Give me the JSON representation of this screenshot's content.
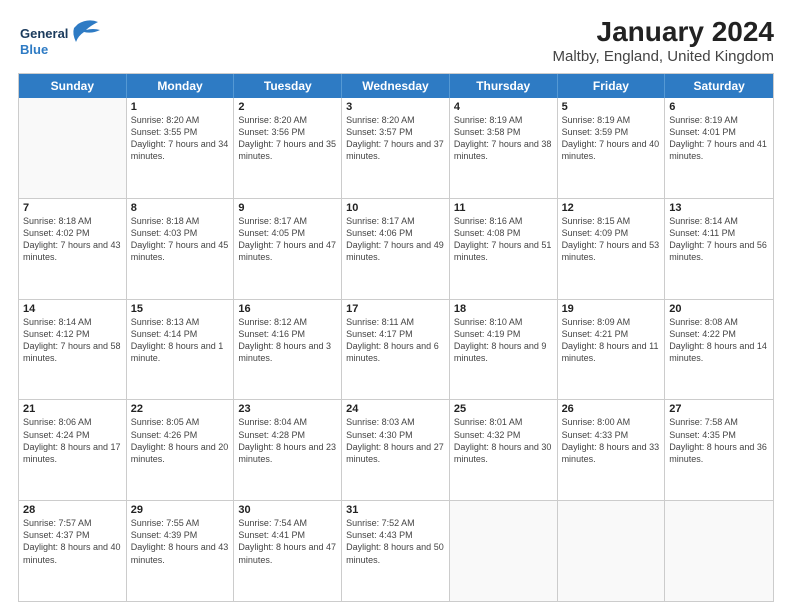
{
  "header": {
    "logo_general": "General",
    "logo_blue": "Blue",
    "month": "January 2024",
    "location": "Maltby, England, United Kingdom"
  },
  "days_of_week": [
    "Sunday",
    "Monday",
    "Tuesday",
    "Wednesday",
    "Thursday",
    "Friday",
    "Saturday"
  ],
  "weeks": [
    [
      {
        "day": "",
        "sunrise": "",
        "sunset": "",
        "daylight": ""
      },
      {
        "day": "1",
        "sunrise": "Sunrise: 8:20 AM",
        "sunset": "Sunset: 3:55 PM",
        "daylight": "Daylight: 7 hours and 34 minutes."
      },
      {
        "day": "2",
        "sunrise": "Sunrise: 8:20 AM",
        "sunset": "Sunset: 3:56 PM",
        "daylight": "Daylight: 7 hours and 35 minutes."
      },
      {
        "day": "3",
        "sunrise": "Sunrise: 8:20 AM",
        "sunset": "Sunset: 3:57 PM",
        "daylight": "Daylight: 7 hours and 37 minutes."
      },
      {
        "day": "4",
        "sunrise": "Sunrise: 8:19 AM",
        "sunset": "Sunset: 3:58 PM",
        "daylight": "Daylight: 7 hours and 38 minutes."
      },
      {
        "day": "5",
        "sunrise": "Sunrise: 8:19 AM",
        "sunset": "Sunset: 3:59 PM",
        "daylight": "Daylight: 7 hours and 40 minutes."
      },
      {
        "day": "6",
        "sunrise": "Sunrise: 8:19 AM",
        "sunset": "Sunset: 4:01 PM",
        "daylight": "Daylight: 7 hours and 41 minutes."
      }
    ],
    [
      {
        "day": "7",
        "sunrise": "Sunrise: 8:18 AM",
        "sunset": "Sunset: 4:02 PM",
        "daylight": "Daylight: 7 hours and 43 minutes."
      },
      {
        "day": "8",
        "sunrise": "Sunrise: 8:18 AM",
        "sunset": "Sunset: 4:03 PM",
        "daylight": "Daylight: 7 hours and 45 minutes."
      },
      {
        "day": "9",
        "sunrise": "Sunrise: 8:17 AM",
        "sunset": "Sunset: 4:05 PM",
        "daylight": "Daylight: 7 hours and 47 minutes."
      },
      {
        "day": "10",
        "sunrise": "Sunrise: 8:17 AM",
        "sunset": "Sunset: 4:06 PM",
        "daylight": "Daylight: 7 hours and 49 minutes."
      },
      {
        "day": "11",
        "sunrise": "Sunrise: 8:16 AM",
        "sunset": "Sunset: 4:08 PM",
        "daylight": "Daylight: 7 hours and 51 minutes."
      },
      {
        "day": "12",
        "sunrise": "Sunrise: 8:15 AM",
        "sunset": "Sunset: 4:09 PM",
        "daylight": "Daylight: 7 hours and 53 minutes."
      },
      {
        "day": "13",
        "sunrise": "Sunrise: 8:14 AM",
        "sunset": "Sunset: 4:11 PM",
        "daylight": "Daylight: 7 hours and 56 minutes."
      }
    ],
    [
      {
        "day": "14",
        "sunrise": "Sunrise: 8:14 AM",
        "sunset": "Sunset: 4:12 PM",
        "daylight": "Daylight: 7 hours and 58 minutes."
      },
      {
        "day": "15",
        "sunrise": "Sunrise: 8:13 AM",
        "sunset": "Sunset: 4:14 PM",
        "daylight": "Daylight: 8 hours and 1 minute."
      },
      {
        "day": "16",
        "sunrise": "Sunrise: 8:12 AM",
        "sunset": "Sunset: 4:16 PM",
        "daylight": "Daylight: 8 hours and 3 minutes."
      },
      {
        "day": "17",
        "sunrise": "Sunrise: 8:11 AM",
        "sunset": "Sunset: 4:17 PM",
        "daylight": "Daylight: 8 hours and 6 minutes."
      },
      {
        "day": "18",
        "sunrise": "Sunrise: 8:10 AM",
        "sunset": "Sunset: 4:19 PM",
        "daylight": "Daylight: 8 hours and 9 minutes."
      },
      {
        "day": "19",
        "sunrise": "Sunrise: 8:09 AM",
        "sunset": "Sunset: 4:21 PM",
        "daylight": "Daylight: 8 hours and 11 minutes."
      },
      {
        "day": "20",
        "sunrise": "Sunrise: 8:08 AM",
        "sunset": "Sunset: 4:22 PM",
        "daylight": "Daylight: 8 hours and 14 minutes."
      }
    ],
    [
      {
        "day": "21",
        "sunrise": "Sunrise: 8:06 AM",
        "sunset": "Sunset: 4:24 PM",
        "daylight": "Daylight: 8 hours and 17 minutes."
      },
      {
        "day": "22",
        "sunrise": "Sunrise: 8:05 AM",
        "sunset": "Sunset: 4:26 PM",
        "daylight": "Daylight: 8 hours and 20 minutes."
      },
      {
        "day": "23",
        "sunrise": "Sunrise: 8:04 AM",
        "sunset": "Sunset: 4:28 PM",
        "daylight": "Daylight: 8 hours and 23 minutes."
      },
      {
        "day": "24",
        "sunrise": "Sunrise: 8:03 AM",
        "sunset": "Sunset: 4:30 PM",
        "daylight": "Daylight: 8 hours and 27 minutes."
      },
      {
        "day": "25",
        "sunrise": "Sunrise: 8:01 AM",
        "sunset": "Sunset: 4:32 PM",
        "daylight": "Daylight: 8 hours and 30 minutes."
      },
      {
        "day": "26",
        "sunrise": "Sunrise: 8:00 AM",
        "sunset": "Sunset: 4:33 PM",
        "daylight": "Daylight: 8 hours and 33 minutes."
      },
      {
        "day": "27",
        "sunrise": "Sunrise: 7:58 AM",
        "sunset": "Sunset: 4:35 PM",
        "daylight": "Daylight: 8 hours and 36 minutes."
      }
    ],
    [
      {
        "day": "28",
        "sunrise": "Sunrise: 7:57 AM",
        "sunset": "Sunset: 4:37 PM",
        "daylight": "Daylight: 8 hours and 40 minutes."
      },
      {
        "day": "29",
        "sunrise": "Sunrise: 7:55 AM",
        "sunset": "Sunset: 4:39 PM",
        "daylight": "Daylight: 8 hours and 43 minutes."
      },
      {
        "day": "30",
        "sunrise": "Sunrise: 7:54 AM",
        "sunset": "Sunset: 4:41 PM",
        "daylight": "Daylight: 8 hours and 47 minutes."
      },
      {
        "day": "31",
        "sunrise": "Sunrise: 7:52 AM",
        "sunset": "Sunset: 4:43 PM",
        "daylight": "Daylight: 8 hours and 50 minutes."
      },
      {
        "day": "",
        "sunrise": "",
        "sunset": "",
        "daylight": ""
      },
      {
        "day": "",
        "sunrise": "",
        "sunset": "",
        "daylight": ""
      },
      {
        "day": "",
        "sunrise": "",
        "sunset": "",
        "daylight": ""
      }
    ]
  ]
}
